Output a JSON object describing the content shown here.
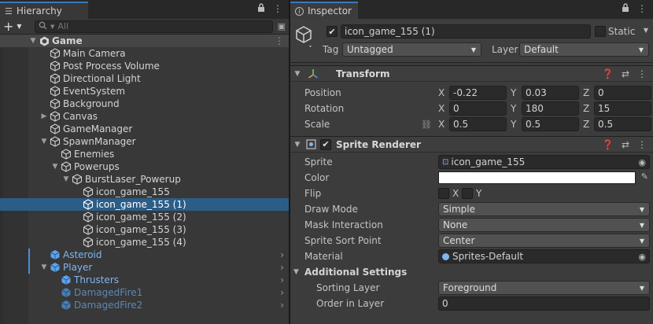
{
  "hierarchy": {
    "tab_label": "Hierarchy",
    "add_label": "+",
    "search_placeholder": "All",
    "scene_name": "Game",
    "items": [
      {
        "label": "Main Camera"
      },
      {
        "label": "Post Process Volume"
      },
      {
        "label": "Directional Light"
      },
      {
        "label": "EventSystem"
      },
      {
        "label": "Background"
      },
      {
        "label": "Canvas"
      },
      {
        "label": "GameManager"
      },
      {
        "label": "SpawnManager"
      },
      {
        "label": "Enemies"
      },
      {
        "label": "Powerups"
      },
      {
        "label": "BurstLaser_Powerup"
      },
      {
        "label": "icon_game_155"
      },
      {
        "label": "icon_game_155 (1)"
      },
      {
        "label": "icon_game_155 (2)"
      },
      {
        "label": "icon_game_155 (3)"
      },
      {
        "label": "icon_game_155 (4)"
      },
      {
        "label": "Asteroid"
      },
      {
        "label": "Player"
      },
      {
        "label": "Thrusters"
      },
      {
        "label": "DamagedFire1"
      },
      {
        "label": "DamagedFire2"
      }
    ]
  },
  "inspector": {
    "tab_label": "Inspector",
    "object_name": "icon_game_155 (1)",
    "static_label": "Static",
    "tag_label": "Tag",
    "tag_value": "Untagged",
    "layer_label": "Layer",
    "layer_value": "Default",
    "transform": {
      "title": "Transform",
      "position": {
        "label": "Position",
        "x": "-0.22",
        "y": "0.03",
        "z": "0"
      },
      "rotation": {
        "label": "Rotation",
        "x": "0",
        "y": "180",
        "z": "15"
      },
      "scale": {
        "label": "Scale",
        "x": "0.5",
        "y": "0.5",
        "z": "0.5"
      },
      "axis_x": "X",
      "axis_y": "Y",
      "axis_z": "Z"
    },
    "sprite_renderer": {
      "title": "Sprite Renderer",
      "sprite_label": "Sprite",
      "sprite_value": "icon_game_155",
      "color_label": "Color",
      "color_value": "#ffffff",
      "flip_label": "Flip",
      "flip_x": "X",
      "flip_y": "Y",
      "draw_mode_label": "Draw Mode",
      "draw_mode_value": "Simple",
      "mask_label": "Mask Interaction",
      "mask_value": "None",
      "sort_point_label": "Sprite Sort Point",
      "sort_point_value": "Center",
      "material_label": "Material",
      "material_value": "Sprites-Default",
      "additional_label": "Additional Settings",
      "sorting_layer_label": "Sorting Layer",
      "sorting_layer_value": "Foreground",
      "order_label": "Order in Layer",
      "order_value": "0"
    }
  },
  "colors": {
    "selection": "#2c5d87",
    "prefab_text": "#7fb6f0",
    "accent": "#3a79bb"
  }
}
